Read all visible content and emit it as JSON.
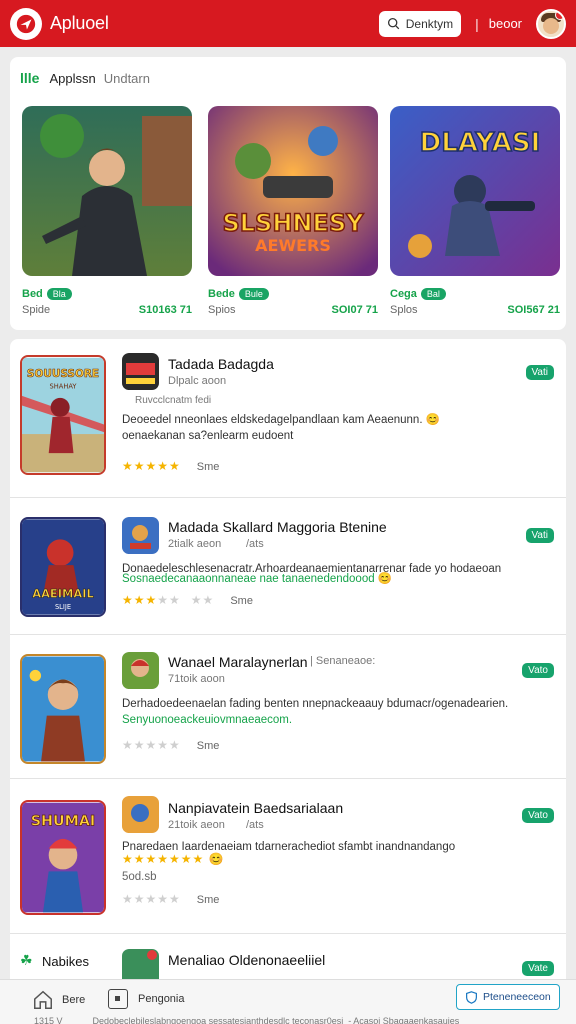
{
  "header": {
    "app_name": "Apluoel",
    "search_label": "Denktym",
    "divider": "|",
    "link": "beoor",
    "colors": {
      "bar": "#d71920"
    }
  },
  "featured": {
    "mark": "llle",
    "title": "Applssn",
    "subtitle": "Undtarn",
    "items": [
      {
        "name": "Bed",
        "pill": "Bla",
        "left": "Spide",
        "right": "S10163 71",
        "icon": "hero-jacket-art"
      },
      {
        "name": "Bede",
        "pill": "Bule",
        "left": "Spios",
        "right": "SOI07 71",
        "icon": "slshness-art",
        "art_title": "SLSHNESY",
        "art_sub": "AEWERS"
      },
      {
        "name": "Cega",
        "pill": "Bal",
        "left": "Splos",
        "right": "SOI567 21",
        "icon": "dlayasi-art",
        "art_title": "DLAYASI"
      }
    ]
  },
  "list": {
    "rows": [
      {
        "title": "Tadada Badagda",
        "subtitle": "Dlpalc aoon",
        "subtitle_extra": "Ruvcclcnatm fedi",
        "desc": "Deoeedel nneonlaes eldskedagelpandlaan kam Aeaenunn. 😊",
        "desc2": "oenaekanan sa?enlearm eudoent",
        "rating": 5,
        "size": "Sme",
        "badge": "Vati",
        "cover_text": "SOUUSSORE",
        "cover_sub": "SHAHAY"
      },
      {
        "title": "Madada Skallard Maggoria Btenine",
        "subtitle": "2tialk aeon",
        "subtitle_extra": "/ats",
        "desc": "Donaedeleschlesenacratr.Arhoardeanaemientanarrenar fade yo hodaeoan",
        "desc2": "Sosnaedecanaaonnaneae nae tanaenedendoood 😊",
        "rating": 3,
        "size": "Sme",
        "badge": "Vati",
        "cover_text": "AAEIMAIL",
        "cover_sub": "SLIJE"
      },
      {
        "title": "Wanael Maralaynerlan",
        "subtitle": "71toik aoon",
        "subtitle_extra": "| Senaneaoe:",
        "desc": "Derhadoedeenaelan fading benten nnepnackeaauy bdumacr/ogenadearien.",
        "desc2": "Senyuonoeackeuiovmnaeaecom.",
        "rating": 0,
        "size": "Sme",
        "badge": "Vato"
      },
      {
        "title": "Nanpiavatein Baedsarialaan",
        "subtitle": "21toik aeon",
        "subtitle_extra": "/ats",
        "desc": "Pnaredaen Iaardenaeiam tdarnerachediot sfambt inandnandango",
        "stars_inline": 7,
        "desc3": "5od.sb",
        "rating": 0,
        "size": "Sme",
        "badge": "Vato",
        "cover_text": "SHUMAI"
      },
      {
        "section_label": "Nabikes",
        "title": "Menaliao Oldenonaeeliiel",
        "badge": "Vate"
      }
    ]
  },
  "bottom": {
    "nav_a": "Bere",
    "nav_b": "Pengonia",
    "cta": "Pteneneeceon",
    "footer_left": "1315 V",
    "footer_mid": "Dedobeclebileslabngoengoa sessatesianthdesdlc teconasr0esi",
    "footer_right": "-  Acasoi Sbagaaenkasauies"
  }
}
